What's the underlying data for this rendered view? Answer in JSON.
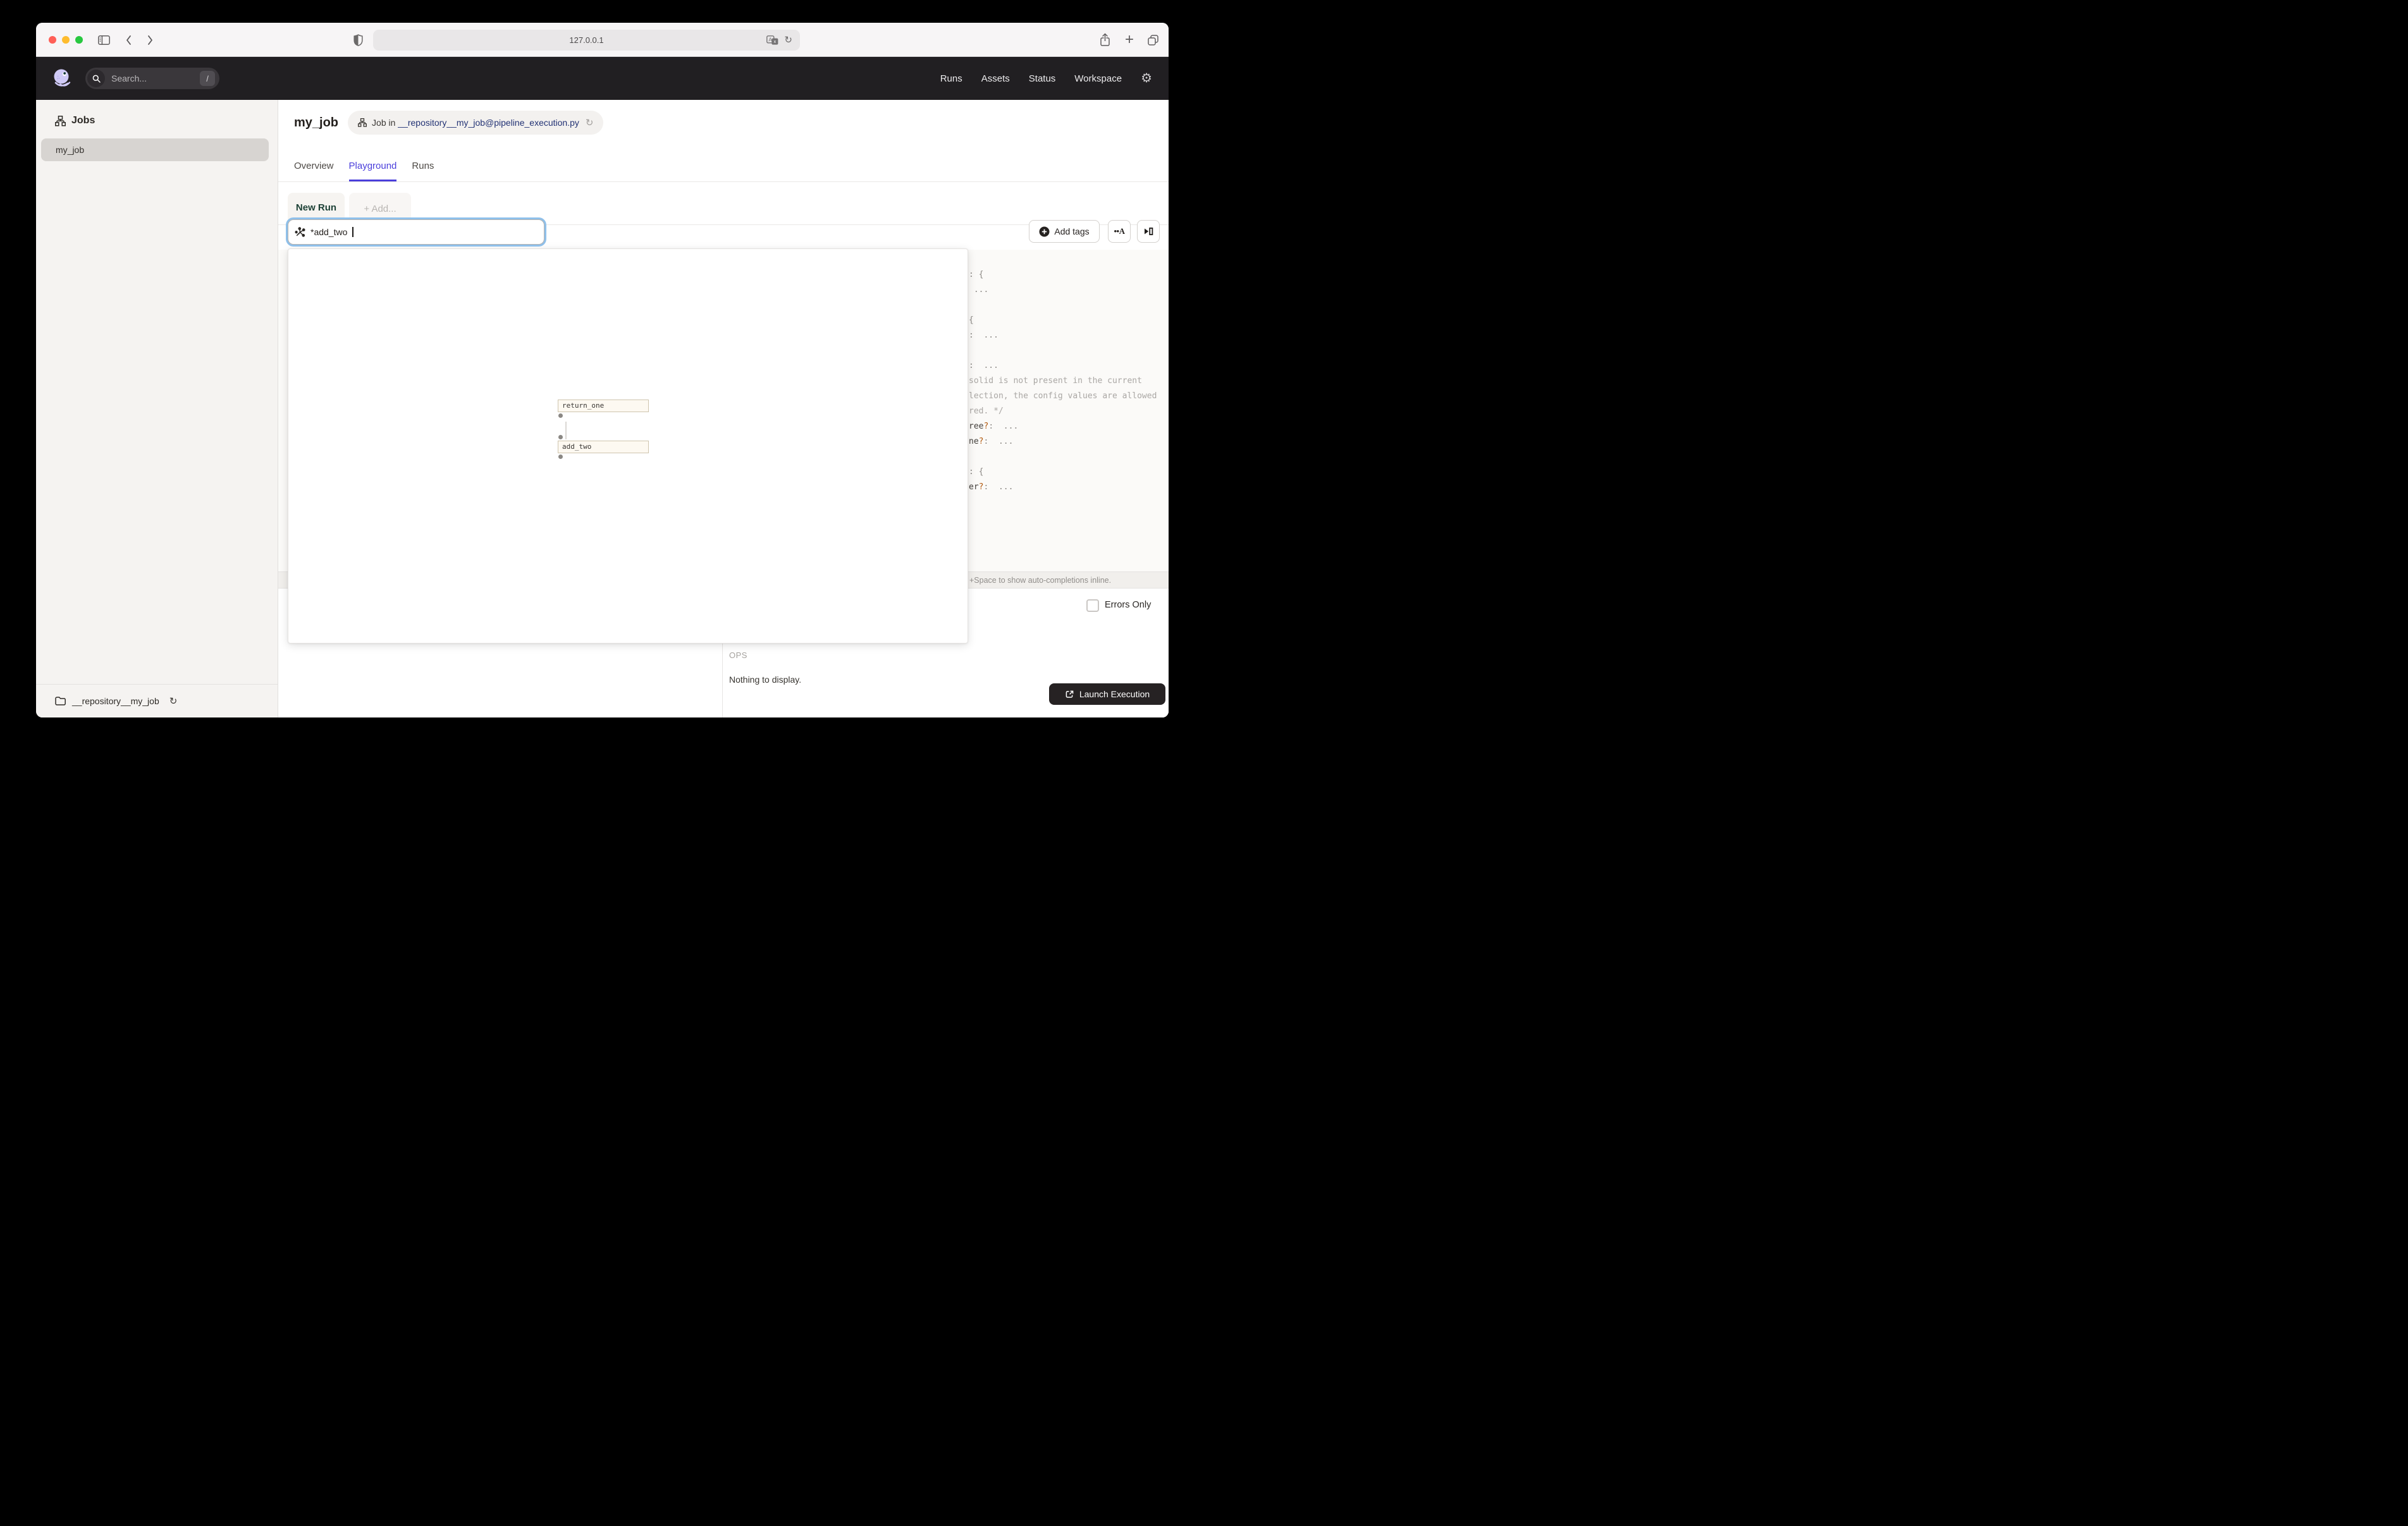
{
  "browser": {
    "url": "127.0.0.1"
  },
  "header": {
    "search_placeholder": "Search...",
    "search_shortcut": "/",
    "nav": [
      "Runs",
      "Assets",
      "Status",
      "Workspace"
    ]
  },
  "sidebar": {
    "section_label": "Jobs",
    "items": [
      "my_job"
    ],
    "footer_repo": "__repository__my_job"
  },
  "main": {
    "title": "my_job",
    "badge": {
      "prefix": "Job in ",
      "link": "__repository__my_job@pipeline_execution.py"
    },
    "tabs": [
      "Overview",
      "Playground",
      "Runs"
    ],
    "active_tab": "Playground",
    "run_tabs": {
      "active": "New Run",
      "add": "+ Add..."
    },
    "op_selector": {
      "value": "*add_two"
    },
    "toolbar": {
      "add_tags": "Add tags",
      "autocomplete_glyph": "••A"
    },
    "graph": {
      "nodes": [
        "return_one",
        "add_two"
      ]
    },
    "editor": {
      "status": "+Space to show auto-completions inline.",
      "lines": [
        {
          "pre": "",
          "accent": "",
          "post": ": {",
          "comment": ""
        },
        {
          "pre": "",
          "accent": "",
          "post": " ...",
          "comment": ""
        },
        {
          "pre": "",
          "accent": "",
          "post": "",
          "comment": ""
        },
        {
          "pre": "",
          "accent": "",
          "post": "{",
          "comment": ""
        },
        {
          "pre": "",
          "accent": "",
          "post": ":  ...",
          "comment": ""
        },
        {
          "pre": "",
          "accent": "",
          "post": "",
          "comment": ""
        },
        {
          "pre": "",
          "accent": "",
          "post": ":  ...",
          "comment": ""
        },
        {
          "pre": "",
          "accent": "",
          "post": "",
          "comment": "solid is not present in the current"
        },
        {
          "pre": "",
          "accent": "",
          "post": "",
          "comment": "lection, the config values are allowed"
        },
        {
          "pre": "",
          "accent": "",
          "post": "",
          "comment": "red. */"
        },
        {
          "pre": "ree",
          "accent": "?",
          "post": ":  ...",
          "comment": ""
        },
        {
          "pre": "ne",
          "accent": "?",
          "post": ":  ...",
          "comment": ""
        },
        {
          "pre": "",
          "accent": "",
          "post": "",
          "comment": ""
        },
        {
          "pre": "",
          "accent": "",
          "post": ": {",
          "comment": ""
        },
        {
          "pre": "er",
          "accent": "?",
          "post": ":  ...",
          "comment": ""
        }
      ]
    },
    "bottom": {
      "errors_only": "Errors Only",
      "ops_label": "OPS",
      "empty": "Nothing to display.",
      "launch": "Launch Execution"
    }
  },
  "icons": {
    "traffic_light_colors": [
      "#ff5f57",
      "#febc2e",
      "#28c840"
    ],
    "gear": "⚙",
    "reload": "↻",
    "plus": "+"
  },
  "colors": {
    "header_bg": "#211f22",
    "accent_purple": "#4a3edb",
    "accent_green": "#1d4136",
    "focus_ring": "#8fc0ea",
    "link_navy": "#223274",
    "node_bg": "#fdf9f1",
    "node_border": "#cfc5ae",
    "launch_bg": "#262223"
  }
}
